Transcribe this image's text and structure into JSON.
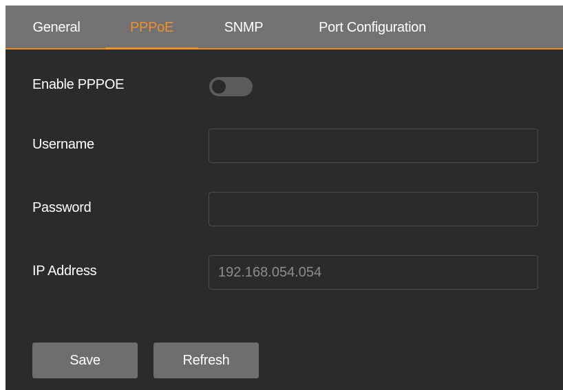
{
  "tabs": [
    {
      "label": "General",
      "active": false
    },
    {
      "label": "PPPoE",
      "active": true
    },
    {
      "label": "SNMP",
      "active": false
    },
    {
      "label": "Port Configuration",
      "active": false
    }
  ],
  "form": {
    "enable_label": "Enable PPPOE",
    "enable_value": false,
    "username_label": "Username",
    "username_value": "",
    "password_label": "Password",
    "password_value": "",
    "ip_label": "IP Address",
    "ip_value": "192.168.054.054"
  },
  "buttons": {
    "save_label": "Save",
    "refresh_label": "Refresh"
  },
  "colors": {
    "accent": "#f0902a",
    "tabbar_bg": "#727272",
    "panel_bg": "#2b2b2b",
    "button_bg": "#6e6e6e"
  }
}
